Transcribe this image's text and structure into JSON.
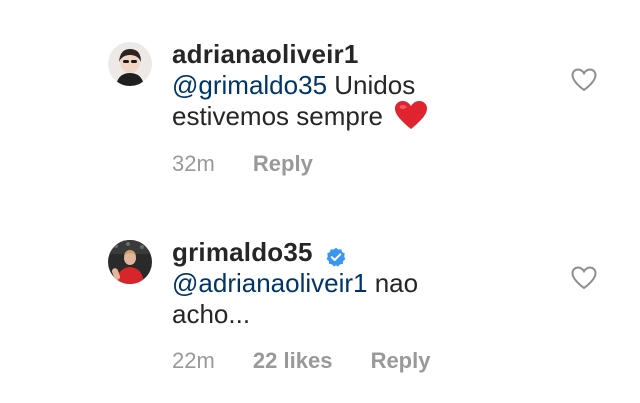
{
  "comments": [
    {
      "username": "adrianaoliveir1",
      "verified": false,
      "mention": "@grimaldo35",
      "text_line1_rest": " Unidos",
      "text_line2": "estivemos sempre",
      "emoji": "heart-emoji",
      "time": "32m",
      "reply_label": "Reply"
    },
    {
      "username": "grimaldo35",
      "verified": true,
      "mention": "@adrianaoliveir1",
      "text_line1_rest": " nao",
      "text_line2": "acho...",
      "time": "22m",
      "likes": "22 likes",
      "reply_label": "Reply"
    }
  ],
  "colors": {
    "text": "#262626",
    "mention": "#003569",
    "meta": "#999999",
    "verified": "#3897f0",
    "heart": "#e0242f"
  }
}
